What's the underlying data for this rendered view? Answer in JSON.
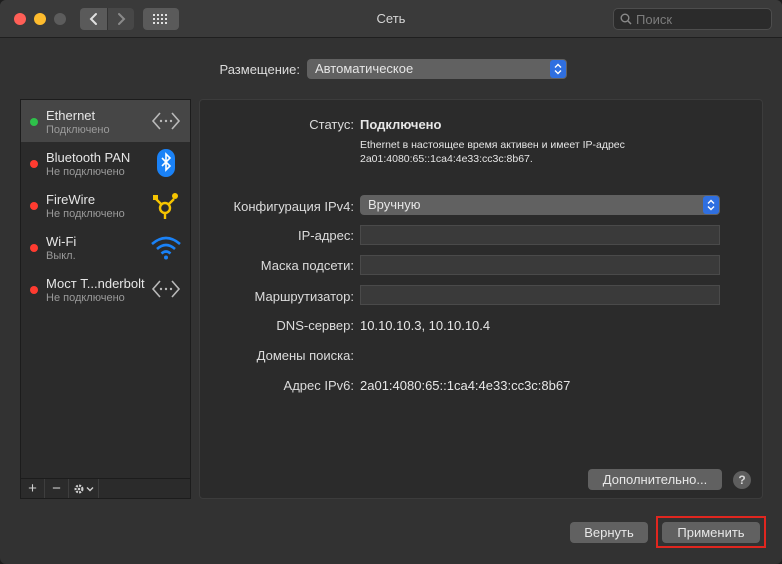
{
  "window": {
    "title": "Сеть",
    "search_placeholder": "Поиск",
    "back_icon": "chevron-left-icon",
    "forward_icon": "chevron-right-icon",
    "show_all_icon": "grid-icon"
  },
  "location": {
    "label": "Размещение:",
    "value": "Автоматическое"
  },
  "services": [
    {
      "name": "Ethernet",
      "status": "Подключено",
      "dot_color": "#2ec14a",
      "icon": "ethernet-icon",
      "selected": true
    },
    {
      "name": "Bluetooth PAN",
      "status": "Не подключено",
      "dot_color": "#ff3b30",
      "icon": "bluetooth-icon",
      "selected": false
    },
    {
      "name": "FireWire",
      "status": "Не подключено",
      "dot_color": "#ff3b30",
      "icon": "firewire-icon",
      "selected": false
    },
    {
      "name": "Wi-Fi",
      "status": "Выкл.",
      "dot_color": "#ff3b30",
      "icon": "wifi-icon",
      "selected": false
    },
    {
      "name": "Мост T...nderbolt",
      "status": "Не подключено",
      "dot_color": "#ff3b30",
      "icon": "thunderbolt-bridge-icon",
      "selected": false
    }
  ],
  "sidebar_buttons": {
    "add": "+",
    "remove": "−",
    "action_icon": "gear-icon"
  },
  "details": {
    "status_label": "Статус:",
    "status_value": "Подключено",
    "status_desc_line1": "Ethernet в настоящее время активен и имеет IP-адрес",
    "status_desc_line2": "2a01:4080:65::1ca4:4e33:cc3c:8b67.",
    "ipv4_config_label": "Конфигурация IPv4:",
    "ipv4_config_value": "Вручную",
    "ip_label": "IP-адрес:",
    "ip_value": "",
    "mask_label": "Маска подсети:",
    "mask_value": "",
    "router_label": "Маршрутизатор:",
    "router_value": "",
    "dns_label": "DNS-сервер:",
    "dns_value": "10.10.10.3, 10.10.10.4",
    "search_domains_label": "Домены поиска:",
    "ipv6_label": "Адрес IPv6:",
    "ipv6_value": "2a01:4080:65::1ca4:4e33:cc3c:8b67",
    "advanced_button": "Дополнительно...",
    "help_button": "?"
  },
  "footer": {
    "revert_button": "Вернуть",
    "apply_button": "Применить"
  },
  "colors": {
    "accent": "#2f6fe0",
    "highlight": "#e0261f",
    "connected": "#2ec14a",
    "disconnected": "#ff3b30"
  }
}
